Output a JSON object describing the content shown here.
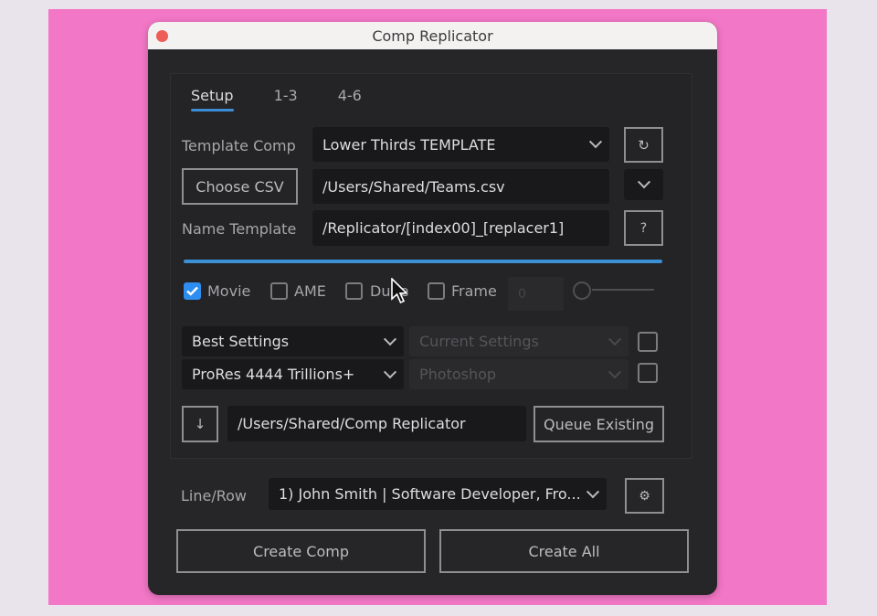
{
  "window": {
    "title": "Comp Replicator"
  },
  "tabs": [
    {
      "label": "Setup",
      "active": true
    },
    {
      "label": "1-3",
      "active": false
    },
    {
      "label": "4-6",
      "active": false
    }
  ],
  "setup": {
    "template_comp_label": "Template Comp",
    "template_comp_value": "Lower Thirds TEMPLATE",
    "refresh_icon": "↻",
    "choose_csv_label": "Choose CSV",
    "csv_path": "/Users/Shared/Teams.csv",
    "name_template_label": "Name Template",
    "name_template_value": "/Replicator/[index00]_[replacer1]",
    "help_label": "?",
    "progress_fraction": 1.0
  },
  "output_options": {
    "checkboxes": [
      {
        "label": "Movie",
        "checked": true
      },
      {
        "label": "AME",
        "checked": false
      },
      {
        "label": "Dupe",
        "checked": false
      },
      {
        "label": "Frame",
        "checked": false
      }
    ],
    "frame_value": "0",
    "render_settings": "Best Settings",
    "output_module": "ProRes 4444 Trillions+",
    "frame_render_settings": "Current Settings",
    "frame_output_module": "Photoshop",
    "output_folder": "/Users/Shared/Comp Replicator",
    "queue_existing_label": "Queue Existing",
    "folder_icon": "↓"
  },
  "footer": {
    "line_row_label": "Line/Row",
    "line_row_value": "1) John Smith | Software Developer, Fro...",
    "settings_icon": "⚙",
    "create_comp_label": "Create Comp",
    "create_all_label": "Create All"
  }
}
